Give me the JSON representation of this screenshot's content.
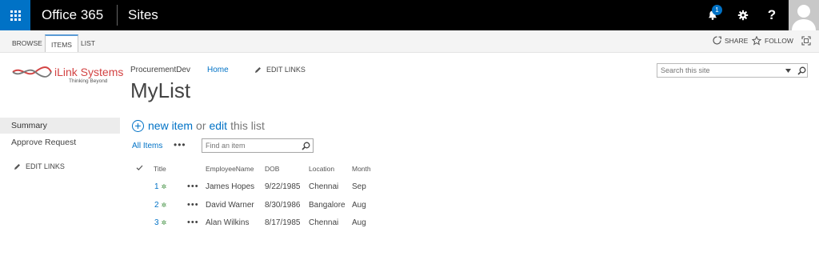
{
  "suite_bar": {
    "brand": "Office 365",
    "app": "Sites",
    "notification_count": "1",
    "help_label": "?",
    "accent": "#0072c6"
  },
  "ribbon": {
    "tabs": [
      "BROWSE",
      "ITEMS",
      "LIST"
    ],
    "active_tab": "ITEMS",
    "share": "SHARE",
    "follow": "FOLLOW"
  },
  "logo": {
    "name": "iLink Systems",
    "tagline": "Thinking Beyond"
  },
  "site": {
    "title": "ProcurementDev",
    "home": "Home",
    "edit_links": "EDIT LINKS",
    "page_title": "MyList",
    "search_placeholder": "Search this site"
  },
  "left_nav": {
    "items": [
      "Summary",
      "Approve Request"
    ],
    "selected": "Summary",
    "edit_links": "EDIT LINKS"
  },
  "list": {
    "new_item": "new item",
    "or": "or",
    "edit": "edit",
    "this_list": "this list",
    "view": "All Items",
    "view_menu": "•••",
    "find_placeholder": "Find an item",
    "columns": [
      "Title",
      "EmployeeName",
      "DOB",
      "Location",
      "Month"
    ],
    "rows": [
      {
        "title": "1",
        "employee": "James Hopes",
        "dob": "9/22/1985",
        "location": "Chennai",
        "month": "Sep"
      },
      {
        "title": "2",
        "employee": "David Warner",
        "dob": "8/30/1986",
        "location": "Bangalore",
        "month": "Aug"
      },
      {
        "title": "3",
        "employee": "Alan Wilkins",
        "dob": "8/17/1985",
        "location": "Chennai",
        "month": "Aug"
      }
    ],
    "row_menu": "•••",
    "new_marker": "✲"
  }
}
